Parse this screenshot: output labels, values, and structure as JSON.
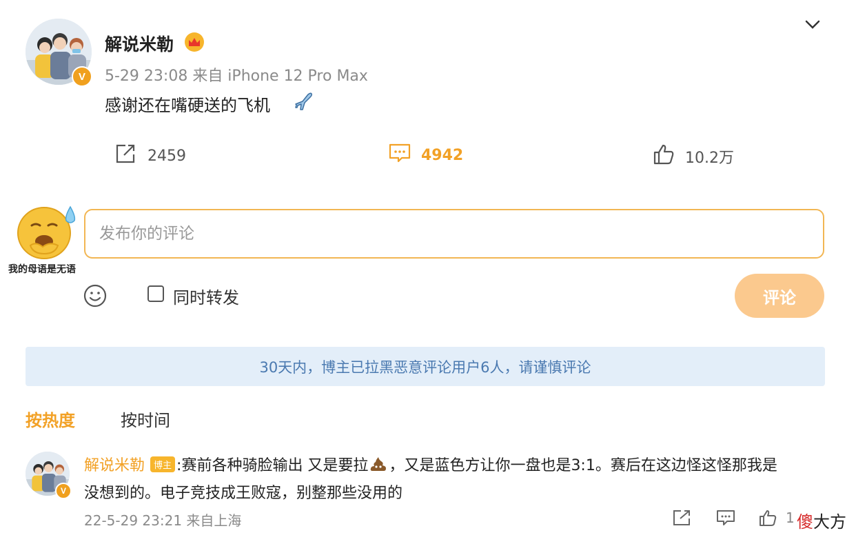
{
  "post": {
    "author": "解说米勒",
    "meta": "5-29 23:08  来自 iPhone 12 Pro Max",
    "text": "感谢还在嘴硬送的飞机",
    "verified_badge": "V"
  },
  "actions": {
    "share_count": "2459",
    "comment_count": "4942",
    "like_count": "10.2万"
  },
  "compose": {
    "user_caption": "我的母语是无语",
    "placeholder": "发布你的评论",
    "repost_label": "同时转发",
    "submit_label": "评论"
  },
  "notice": "30天内，博主已拉黑恶意评论用户6人，请谨慎评论",
  "sort_tabs": [
    "按热度",
    "按时间"
  ],
  "comments": [
    {
      "author": "解说米勒",
      "tag": "博主",
      "text_part1": ":赛前各种骑脸输出 又是要拉",
      "text_part2": "，又是蓝色方让你一盘也是3:1。赛后在这边怪这怪那我是",
      "text_line2": "没想到的。电子竞技成王败寇，别整那些没用的",
      "meta": "22-5-29 23:21  来自上海",
      "like_count": "1"
    }
  ],
  "watermark": {
    "red": "傻",
    "black": "大方"
  },
  "colors": {
    "accent": "#f2a126",
    "notice_bg": "#e3eef9",
    "notice_text": "#4a79b0",
    "button_disabled": "#fbc98e"
  }
}
